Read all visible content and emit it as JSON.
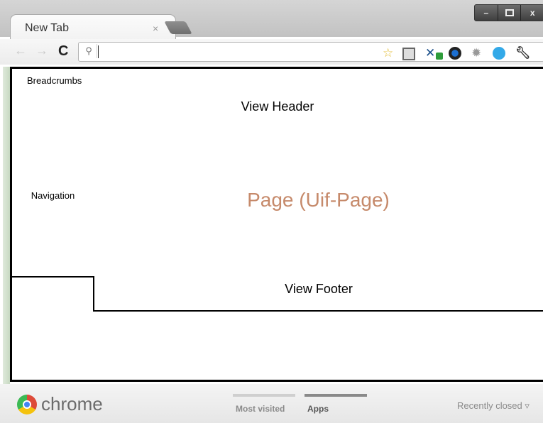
{
  "browser": {
    "tab_title": "New Tab",
    "tab_close": "×",
    "window_controls": [
      "–",
      "",
      "x"
    ],
    "url": ""
  },
  "toolbar": {
    "back_icon": "←",
    "forward_icon": "→",
    "reload_icon": "C",
    "search_icon_glyph": "⚲",
    "star_glyph": "☆",
    "extension_icons": [
      "page-icon",
      "puzzle-icon",
      "color-wheel-icon",
      "gear-icon",
      "skype-icon",
      "wrench-icon"
    ]
  },
  "wireframe": {
    "breadcrumbs": "Breadcrumbs",
    "view_header": "View Header",
    "navigation": "Navigation",
    "page": "Page (Uif-Page)",
    "view_footer": "View Footer"
  },
  "ntp_footer": {
    "logo_text": "chrome",
    "sections": [
      "Most visited",
      "Apps"
    ],
    "active_section": "Apps",
    "recently_closed": "Recently closed ▿"
  },
  "colors": {
    "page_label": "#c68a6b",
    "frame_border": "#000000"
  }
}
